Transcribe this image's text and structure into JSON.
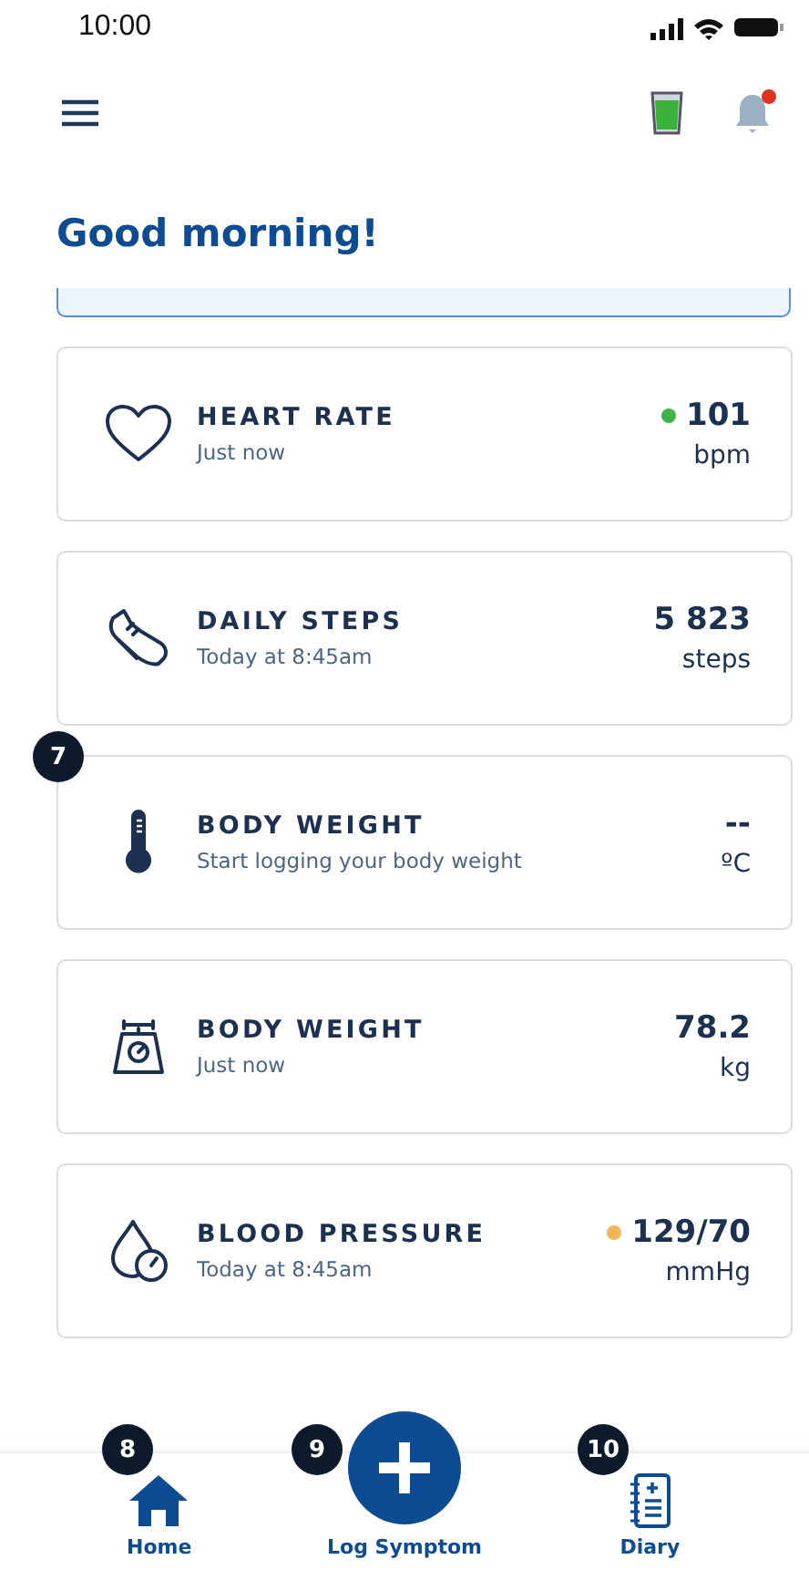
{
  "status_bar": {
    "time": "10:00"
  },
  "header": {
    "notifications": {
      "unread": true
    }
  },
  "greeting": "Good morning!",
  "metrics": [
    {
      "title": "HEART RATE",
      "subtitle": "Just now",
      "value": "101",
      "unit": "bpm",
      "color": "#3bb54a"
    },
    {
      "title": "DAILY STEPS",
      "subtitle": "Today at 8:45am",
      "value": "5 823",
      "unit": "steps"
    },
    {
      "title": "BODY WEIGHT",
      "subtitle": "Start logging your body weight",
      "value": "--",
      "unit": "ºC"
    },
    {
      "title": "BODY WEIGHT",
      "subtitle": "Just now",
      "value": "78.2",
      "unit": "kg"
    },
    {
      "title": "BLOOD PRESSURE",
      "subtitle": "Today at 8:45am",
      "value": "129/70",
      "unit": "mmHg",
      "color": "#f2b65a"
    }
  ],
  "nav": [
    {
      "label": "Home",
      "kind": "tab"
    },
    {
      "label": "Log Symptom",
      "kind": "fab"
    },
    {
      "label": "Diary",
      "kind": "tab"
    }
  ],
  "markers": [
    "7",
    "8",
    "9",
    "10"
  ]
}
